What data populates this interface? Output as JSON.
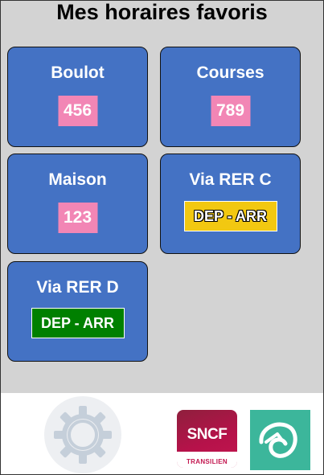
{
  "page": {
    "title": "Mes horaires favoris"
  },
  "cards": [
    {
      "name": "Boulot",
      "badge": "456"
    },
    {
      "name": "Courses",
      "badge": "789"
    },
    {
      "name": "Maison",
      "badge": "123"
    },
    {
      "name": "Via RER C",
      "badge": "DEP - ARR"
    },
    {
      "name": "Via RER D",
      "badge": "DEP - ARR"
    }
  ],
  "footer": {
    "settings_icon": "gear-icon",
    "sncf_logo": {
      "brand": "SNCF",
      "sub": "TRANSILIEN"
    },
    "transilien_icon": "transilien-logo-icon"
  },
  "colors": {
    "background": "#d3d3d3",
    "card": "#4472c4",
    "badge_pink": "#f286b5",
    "rer_c_yellow": "#f2c811",
    "rer_d_green": "#008000",
    "transilien_teal": "#3cb69b"
  }
}
